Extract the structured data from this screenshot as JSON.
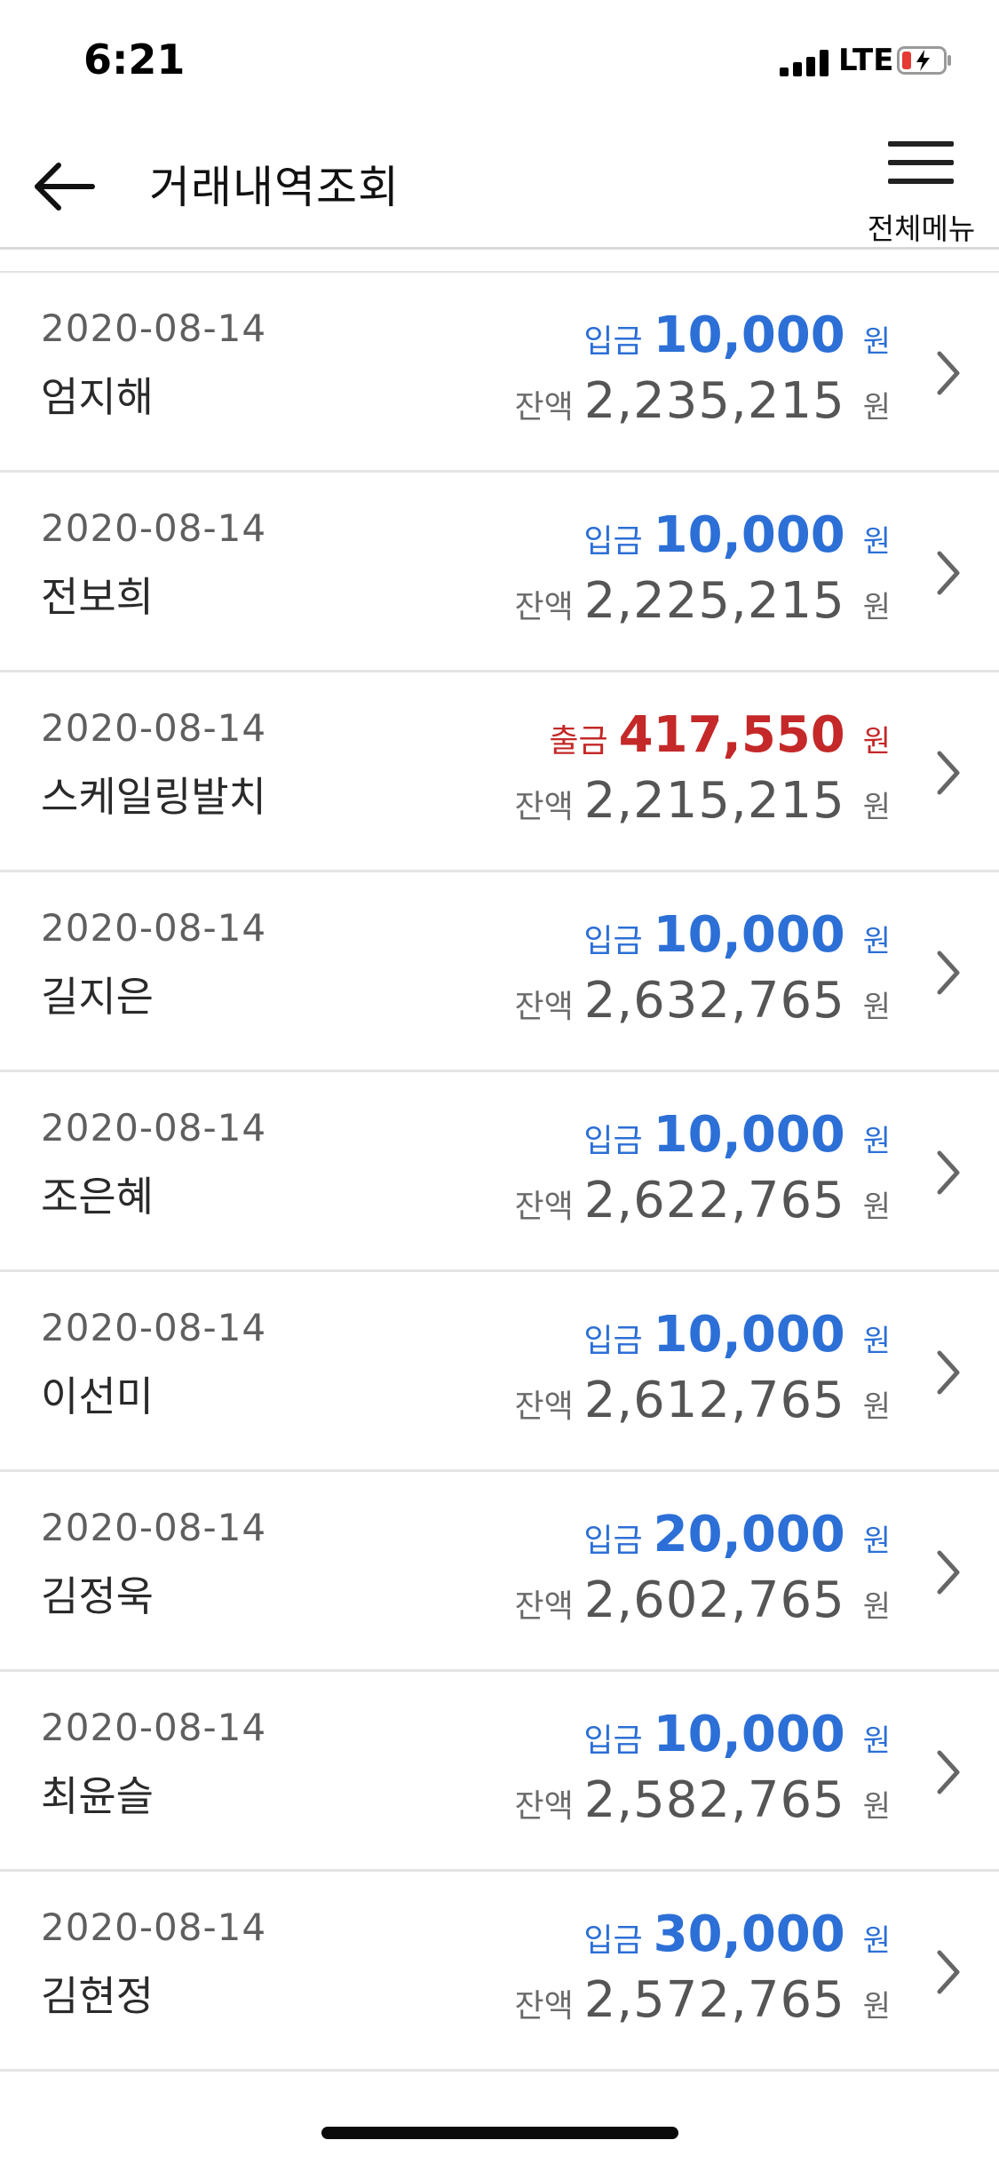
{
  "status_bar": {
    "time": "6:21",
    "network": "LTE",
    "battery_state": "low-charging",
    "battery_color": "#e53935"
  },
  "header": {
    "back_icon": "back-arrow-icon",
    "title": "거래내역조회",
    "menu_icon": "hamburger-menu-icon",
    "menu_label": "전체메뉴"
  },
  "colors": {
    "deposit": "#2c6fd6",
    "withdraw": "#c42828"
  },
  "transactions": [
    {
      "date": "2020-08-14",
      "name": "엄지해",
      "type_label": "입금",
      "kind": "deposit",
      "amount": "10,000",
      "currency": "원",
      "balance_label": "잔액",
      "balance": "2,235,215",
      "balance_currency": "원"
    },
    {
      "date": "2020-08-14",
      "name": "전보희",
      "type_label": "입금",
      "kind": "deposit",
      "amount": "10,000",
      "currency": "원",
      "balance_label": "잔액",
      "balance": "2,225,215",
      "balance_currency": "원"
    },
    {
      "date": "2020-08-14",
      "name": "스케일링발치",
      "type_label": "출금",
      "kind": "withdraw",
      "amount": "417,550",
      "currency": "원",
      "balance_label": "잔액",
      "balance": "2,215,215",
      "balance_currency": "원"
    },
    {
      "date": "2020-08-14",
      "name": "길지은",
      "type_label": "입금",
      "kind": "deposit",
      "amount": "10,000",
      "currency": "원",
      "balance_label": "잔액",
      "balance": "2,632,765",
      "balance_currency": "원"
    },
    {
      "date": "2020-08-14",
      "name": "조은혜",
      "type_label": "입금",
      "kind": "deposit",
      "amount": "10,000",
      "currency": "원",
      "balance_label": "잔액",
      "balance": "2,622,765",
      "balance_currency": "원"
    },
    {
      "date": "2020-08-14",
      "name": "이선미",
      "type_label": "입금",
      "kind": "deposit",
      "amount": "10,000",
      "currency": "원",
      "balance_label": "잔액",
      "balance": "2,612,765",
      "balance_currency": "원"
    },
    {
      "date": "2020-08-14",
      "name": "김정욱",
      "type_label": "입금",
      "kind": "deposit",
      "amount": "20,000",
      "currency": "원",
      "balance_label": "잔액",
      "balance": "2,602,765",
      "balance_currency": "원"
    },
    {
      "date": "2020-08-14",
      "name": "최윤슬",
      "type_label": "입금",
      "kind": "deposit",
      "amount": "10,000",
      "currency": "원",
      "balance_label": "잔액",
      "balance": "2,582,765",
      "balance_currency": "원"
    },
    {
      "date": "2020-08-14",
      "name": "김현정",
      "type_label": "입금",
      "kind": "deposit",
      "amount": "30,000",
      "currency": "원",
      "balance_label": "잔액",
      "balance": "2,572,765",
      "balance_currency": "원"
    }
  ]
}
